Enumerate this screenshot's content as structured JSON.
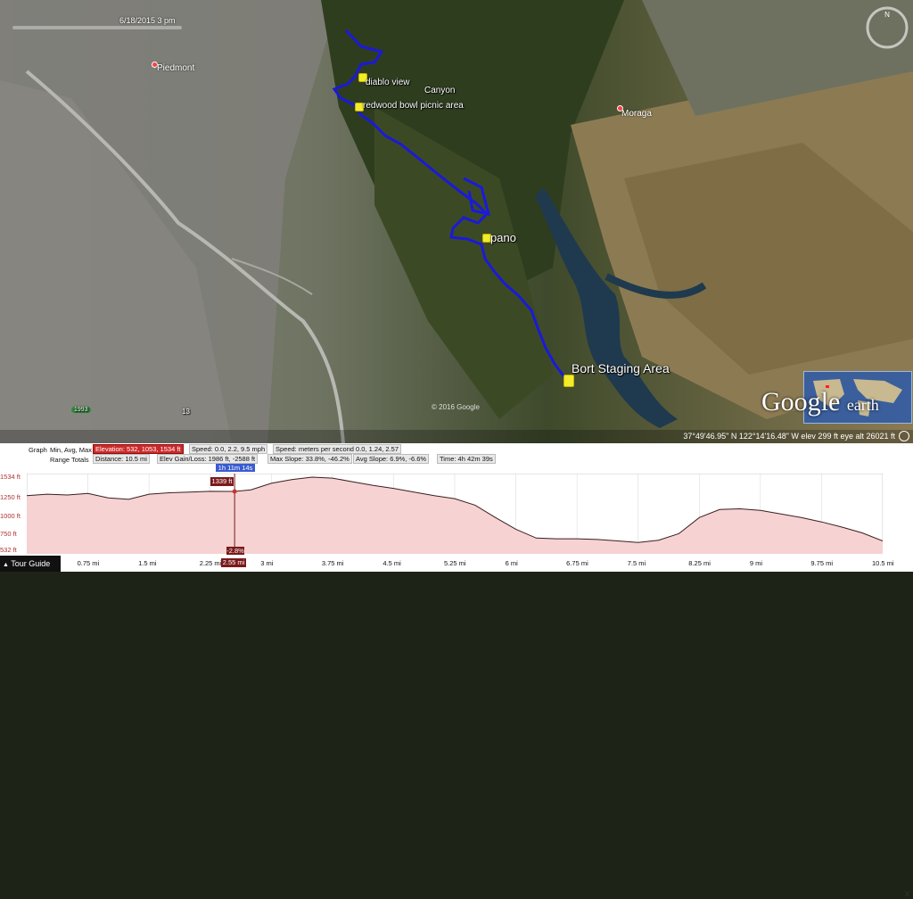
{
  "map": {
    "time_slider_date": "6/18/2015  3 pm",
    "towns": {
      "piedmont": "Piedmont",
      "moraga": "Moraga"
    },
    "placemarks": {
      "diablo_view": "diablo view",
      "canyon": "Canyon",
      "redwood": "redwood bowl picnic area",
      "pano": "pano",
      "bort": "Bort Staging Area"
    },
    "road_shield": "1993",
    "road_label": "13",
    "copyright": "© 2016 Google",
    "status": "37°49'46.95\" N  122°14'16.48\" W  elev  299 ft    eye alt  26021 ft",
    "brand_google": "Google",
    "brand_earth": "earth",
    "track_color": "#1a1ad8",
    "pin_color": "#f2ec2a"
  },
  "profile": {
    "graph_label": "Graph",
    "range_totals_label": "Range Totals",
    "min_avg_max": "Min, Avg, Max",
    "elevation": "Elevation: 532, 1053, 1534 ft",
    "speed": "Speed: 0.0, 2.2, 9.5 mph",
    "speed_unit": "Speed: meters per second  0.0, 1.24, 2.57",
    "distance": "Distance: 10.5 mi",
    "gain_loss": "Elev Gain/Loss: 1986 ft, -2588 ft",
    "max_slope": "Max Slope: 33.8%, -46.2%",
    "avg_slope": "Avg Slope: 6.9%, -6.6%",
    "time": "Time: 4h 42m 39s",
    "cursor_time": "1h 11m 14s",
    "cursor_elev": "1339 ft",
    "cursor_slope": "-2.8%",
    "cursor_dist": "2.55 mi",
    "y_ticks": [
      "1534 ft",
      "1250 ft",
      "1000 ft",
      "750 ft",
      "532 ft"
    ],
    "x_ticks": [
      "0.75 mi",
      "1.5 mi",
      "2.25 mi",
      "3 mi",
      "3.75 mi",
      "4.5 mi",
      "5.25 mi",
      "6 mi",
      "6.75 mi",
      "7.5 mi",
      "8.25 mi",
      "9 mi",
      "9.75 mi",
      "10.5 mi"
    ],
    "close": "x",
    "tour_guide": "Tour Guide"
  },
  "chart_data": {
    "type": "area",
    "title": "",
    "xlabel": "",
    "ylabel": "",
    "ylim": [
      532,
      1534
    ],
    "xlim": [
      0,
      10.5
    ],
    "series": [
      {
        "x": [
          0,
          0.25,
          0.5,
          0.75,
          1.0,
          1.25,
          1.5,
          1.75,
          2.0,
          2.25,
          2.55,
          2.75,
          3.0,
          3.25,
          3.5,
          3.75,
          4.0,
          4.25,
          4.5,
          4.75,
          5.0,
          5.25,
          5.5,
          5.75,
          6.0,
          6.25,
          6.5,
          6.75,
          7.0,
          7.25,
          7.5,
          7.75,
          8.0,
          8.25,
          8.5,
          8.75,
          9.0,
          9.25,
          9.5,
          9.75,
          10.0,
          10.25,
          10.5
        ],
        "values": [
          1280,
          1300,
          1290,
          1310,
          1250,
          1230,
          1300,
          1320,
          1330,
          1340,
          1339,
          1360,
          1450,
          1500,
          1534,
          1520,
          1470,
          1420,
          1380,
          1330,
          1280,
          1240,
          1150,
          980,
          820,
          700,
          690,
          690,
          680,
          660,
          640,
          670,
          760,
          980,
          1090,
          1100,
          1080,
          1030,
          980,
          920,
          850,
          770,
          660
        ]
      }
    ]
  }
}
